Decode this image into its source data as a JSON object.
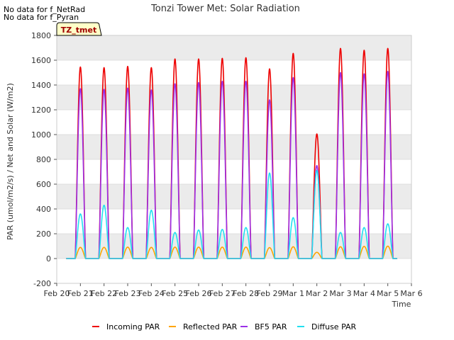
{
  "notes": [
    "No data for f_NetRad",
    "No data for f_Pyran"
  ],
  "chart_data": {
    "type": "line",
    "title": "Tonzi Tower Met: Solar Radiation",
    "xlabel": "Time",
    "ylabel": "PAR (umol/m2/s) / Net and Solar (W/m2)",
    "ylim": [
      -200,
      1800
    ],
    "yticks": [
      -200,
      0,
      200,
      400,
      600,
      800,
      1000,
      1200,
      1400,
      1600,
      1800
    ],
    "xlim": [
      0,
      15
    ],
    "xticks": [
      {
        "x": 0,
        "label": "Feb 20"
      },
      {
        "x": 1,
        "label": "Feb 21"
      },
      {
        "x": 2,
        "label": "Feb 22"
      },
      {
        "x": 3,
        "label": "Feb 23"
      },
      {
        "x": 4,
        "label": "Feb 24"
      },
      {
        "x": 5,
        "label": "Feb 25"
      },
      {
        "x": 6,
        "label": "Feb 26"
      },
      {
        "x": 7,
        "label": "Feb 27"
      },
      {
        "x": 8,
        "label": "Feb 28"
      },
      {
        "x": 9,
        "label": "Feb 29"
      },
      {
        "x": 10,
        "label": "Mar 1"
      },
      {
        "x": 11,
        "label": "Mar 2"
      },
      {
        "x": 12,
        "label": "Mar 3"
      },
      {
        "x": 13,
        "label": "Mar 4"
      },
      {
        "x": 14,
        "label": "Mar 5"
      },
      {
        "x": 15,
        "label": "Mar 6"
      }
    ],
    "tag_label": "TZ_tmet",
    "legend_position": "bottom",
    "grid": true,
    "data_range": [
      0.4,
      14.4
    ],
    "day_center": 0.5,
    "day_halfwidth": 0.22,
    "days": [
      1,
      2,
      3,
      4,
      5,
      6,
      7,
      8,
      9,
      10,
      11,
      12,
      13,
      14
    ],
    "series": [
      {
        "name": "Incoming PAR",
        "color": "#ee0000",
        "peaks": [
          1545,
          1540,
          1550,
          1540,
          1610,
          1610,
          1615,
          1620,
          1530,
          1655,
          1005,
          1695,
          1680,
          1695
        ]
      },
      {
        "name": "Reflected PAR",
        "color": "#ffa500",
        "peaks": [
          90,
          90,
          92,
          90,
          92,
          92,
          92,
          92,
          88,
          95,
          50,
          95,
          98,
          100
        ]
      },
      {
        "name": "BF5 PAR",
        "color": "#9b30e8",
        "peaks": [
          1370,
          1365,
          1375,
          1360,
          1410,
          1420,
          1430,
          1430,
          1280,
          1460,
          750,
          1500,
          1490,
          1510
        ]
      },
      {
        "name": "Diffuse PAR",
        "color": "#22e0f0",
        "peaks": [
          360,
          430,
          250,
          390,
          210,
          230,
          235,
          250,
          690,
          330,
          710,
          210,
          250,
          280
        ]
      }
    ]
  }
}
